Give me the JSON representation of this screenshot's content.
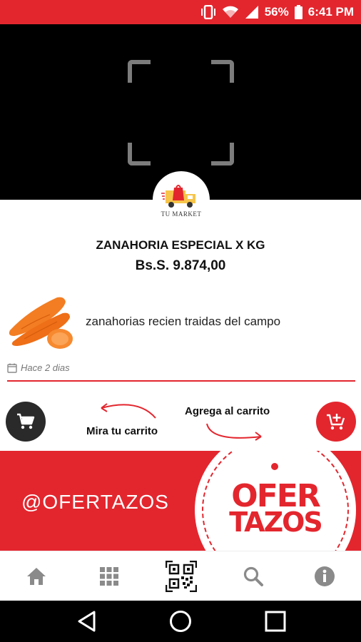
{
  "status_bar": {
    "battery": "56%",
    "time": "6:41 PM",
    "icons": [
      "vibrate-icon",
      "wifi-icon",
      "signal-icon",
      "battery-icon"
    ]
  },
  "scanner": {
    "frame_color": "#7c7c7c"
  },
  "brand": {
    "logo_text": "TU MARKET",
    "accent_color": "#e3262e"
  },
  "product": {
    "name": "ZANAHORIA ESPECIAL X KG",
    "price": "Bs.S. 9.874,00",
    "description": "zanahorias recien traidas del campo",
    "posted": "Hace 2 dias",
    "image": "carrot-image"
  },
  "actions": {
    "view_cart_hint": "Mira tu carrito",
    "add_cart_hint": "Agrega al carrito"
  },
  "banner": {
    "handle": "@OFERTAZOS",
    "promo_line1": "OFER",
    "promo_line2": "TAZOS"
  },
  "bottom_nav": {
    "items": [
      "home-icon",
      "grid-icon",
      "qr-code-icon",
      "search-icon",
      "info-icon"
    ]
  },
  "system_nav": {
    "items": [
      "back-icon",
      "home-circle-icon",
      "recents-icon"
    ]
  }
}
